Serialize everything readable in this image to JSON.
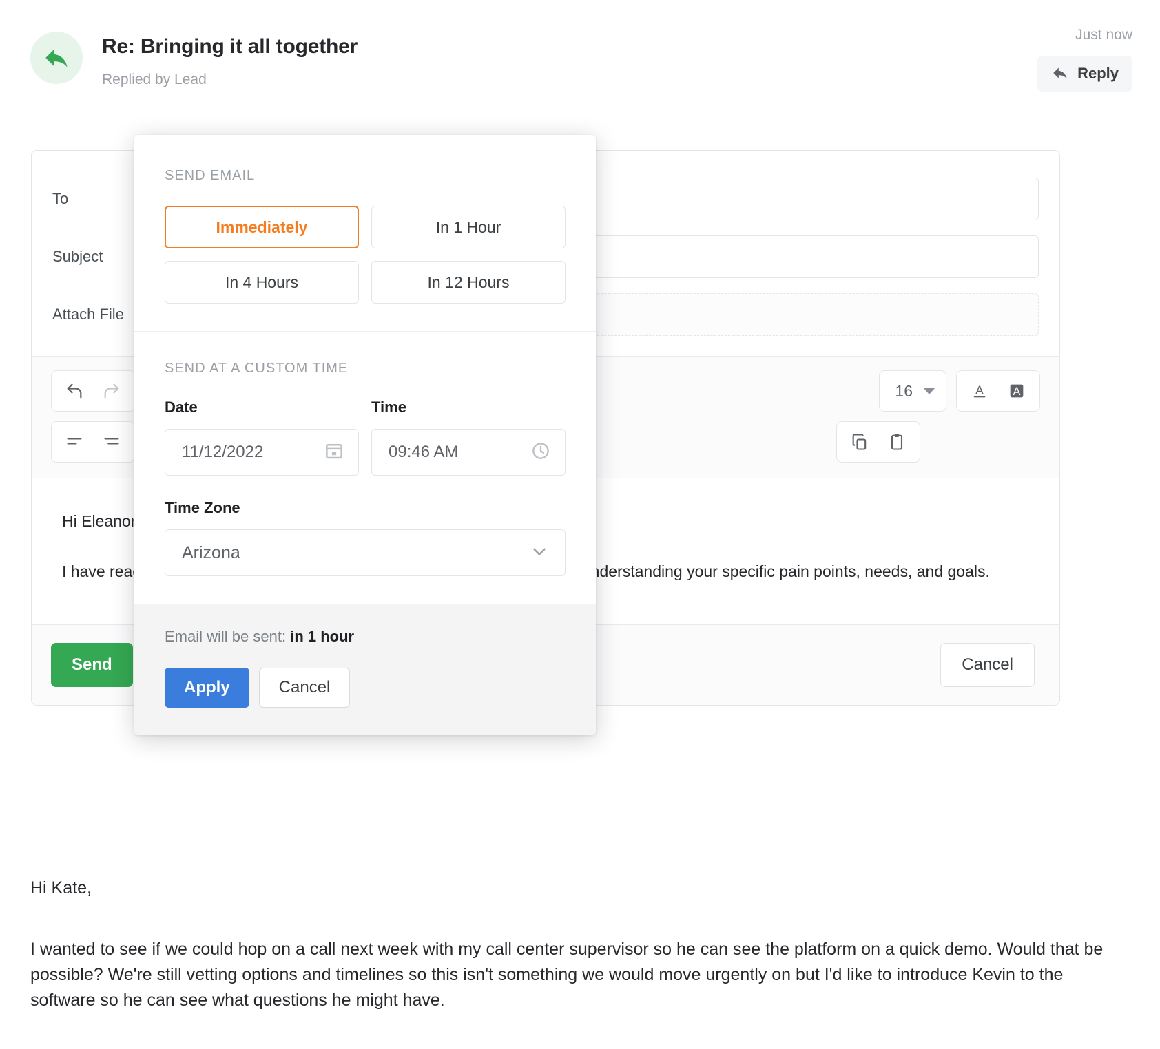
{
  "header": {
    "title": "Re: Bringing it all together",
    "subtitle": "Replied by Lead",
    "timestamp": "Just now",
    "reply_label": "Reply",
    "avatar_icon": "reply-arrow-icon",
    "accent_green": "#34a853",
    "avatar_bg": "#e6f4ea"
  },
  "compose": {
    "fields": [
      {
        "label": "To",
        "value": "",
        "placeholder": ""
      },
      {
        "label": "Subject",
        "value": "",
        "placeholder": ""
      },
      {
        "label": "Attach File",
        "value": "",
        "placeholder": ""
      }
    ],
    "toolbar": {
      "undo_icon": "undo-icon",
      "redo_icon": "redo-icon",
      "align_left_icon": "align-left-icon",
      "align_center_icon": "align-center-icon",
      "font_size": "16",
      "text_color_icon": "text-color-icon",
      "highlight_icon": "text-highlight-icon",
      "copy_icon": "copy-icon",
      "paste_icon": "paste-clipboard-icon"
    },
    "body": {
      "greeting": "Hi Eleanor,",
      "paragraph": "I have reached out a few times but didn't want to set a meeting up without understanding your specific pain points, needs, and goals."
    },
    "footer": {
      "send_label": "Send",
      "cancel_label": "Cancel",
      "schedule_icon": "clock-icon",
      "send_color": "#34a853"
    }
  },
  "popover": {
    "send_email_heading": "SEND EMAIL",
    "quick_options": [
      {
        "label": "Immediately",
        "active": true
      },
      {
        "label": "In 1 Hour",
        "active": false
      },
      {
        "label": "In 4 Hours",
        "active": false
      },
      {
        "label": "In 12 Hours",
        "active": false
      }
    ],
    "custom_heading": "SEND AT A CUSTOM TIME",
    "date_label": "Date",
    "date_value": "11/12/2022",
    "date_icon": "calendar-icon",
    "time_label": "Time",
    "time_value": "09:46 AM",
    "time_icon": "clock-icon",
    "timezone_label": "Time Zone",
    "timezone_value": "Arizona",
    "timezone_caret": "chevron-down-icon",
    "sent_prefix": "Email will be sent:",
    "sent_value": "in 1 hour",
    "apply_label": "Apply",
    "cancel_label": "Cancel",
    "active_color": "#f57c1f",
    "apply_color": "#3b7ddd"
  },
  "quoted": {
    "greeting": "Hi Kate,",
    "paragraph": "I wanted to see if we could hop on a call next week with my call center supervisor so he can see the platform on a quick demo. Would that be possible? We're still vetting options and timelines so this isn't something we would move urgently on but I'd like to introduce Kevin to the software so he can see what questions he might have."
  }
}
